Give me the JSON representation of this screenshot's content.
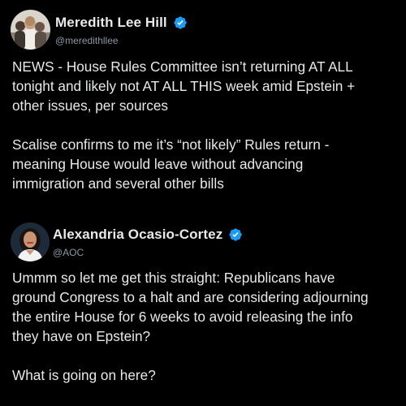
{
  "posts": [
    {
      "author_name": "Meredith Lee Hill",
      "handle": "@meredithllee",
      "verified": true,
      "paragraphs": [
        [
          "NEWS - House Rules Committee isn’t returning AT ALL",
          "tonight and likely not AT ALL THIS week amid Epstein +",
          "other issues, per sources"
        ],
        [
          "Scalise confirms to me it’s “not likely” Rules return -",
          "meaning House would leave without advancing",
          "immigration and several other bills"
        ]
      ]
    },
    {
      "author_name": "Alexandria Ocasio-Cortez",
      "handle": "@AOC",
      "verified": true,
      "paragraphs": [
        [
          "Ummm so let me get this straight: Republicans have",
          "ground Congress to a halt and are considering adjourning",
          "the entire House for 6 weeks to avoid releasing the info",
          "they have on Epstein?"
        ],
        [
          "What is going on here?"
        ]
      ]
    }
  ],
  "colors": {
    "background": "#000000",
    "text": "#e7e9ea",
    "handle": "#8b98a5",
    "verified_badge": "#1d9bf0"
  },
  "icons": {
    "verified": "verified-badge-icon",
    "avatar_1": "profile-photo",
    "avatar_2": "profile-photo"
  }
}
